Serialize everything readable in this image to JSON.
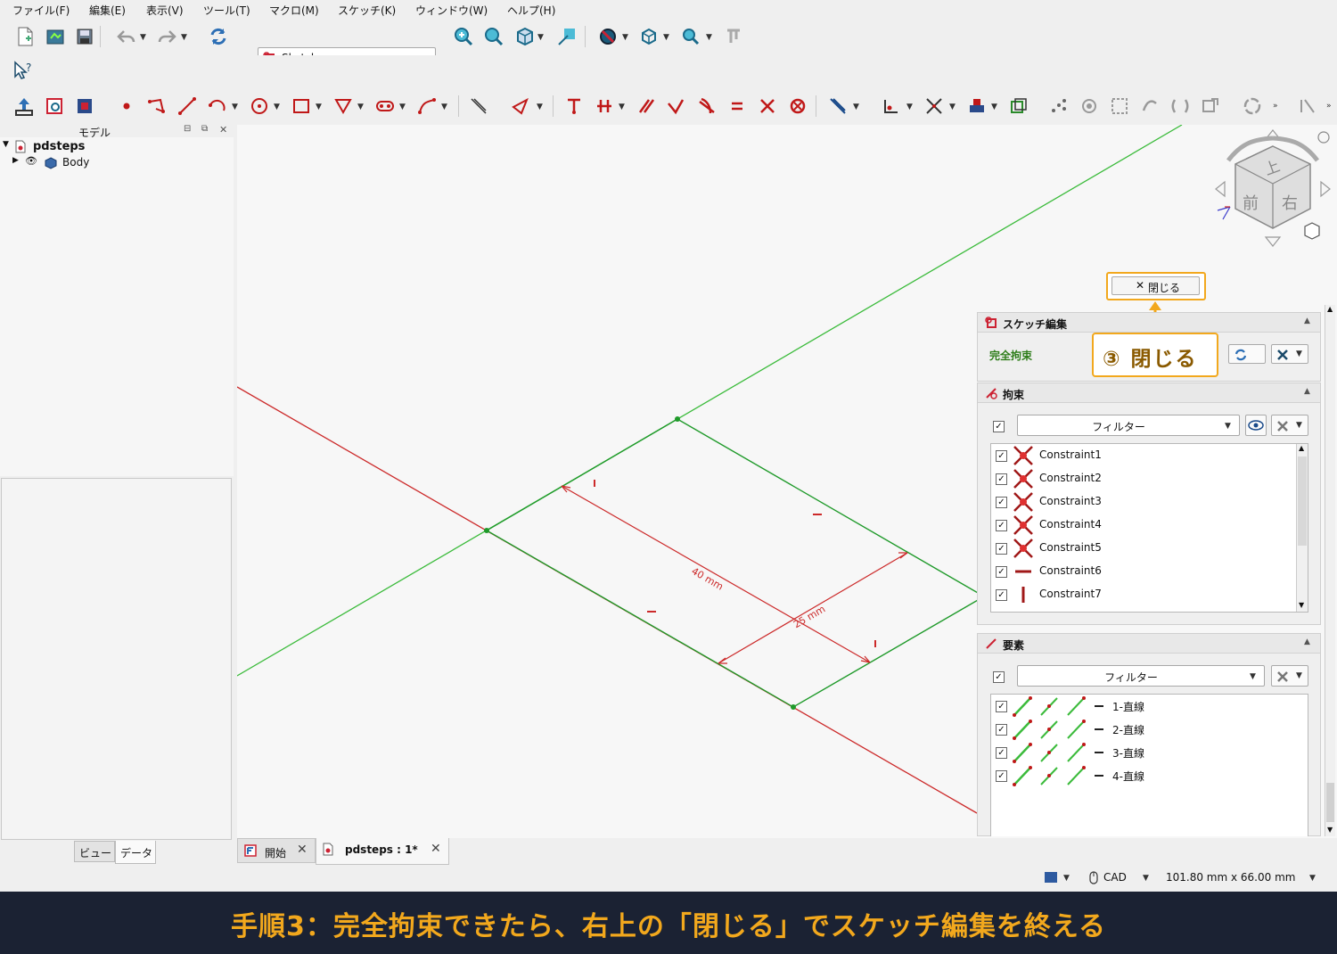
{
  "menu": [
    "ファイル(F)",
    "編集(E)",
    "表示(V)",
    "ツール(T)",
    "マクロ(M)",
    "スケッチ(K)",
    "ウィンドウ(W)",
    "ヘルプ(H)"
  ],
  "toolbar": {
    "workbench": "Sketcher"
  },
  "model_panel": {
    "title": "モデル",
    "tree": [
      {
        "label": "pdsteps"
      },
      {
        "label": "Body"
      }
    ],
    "tabs": [
      "ビュー",
      "データ"
    ]
  },
  "navcube": {
    "top": "上",
    "front": "前",
    "right": "右"
  },
  "viewport": {
    "dim_40": "40 mm",
    "dim_25": "25 mm",
    "close_button": "閉じる"
  },
  "annotation": {
    "label": "③ 閉じる",
    "color": "#f2a81d"
  },
  "sketch_edit": {
    "title": "スケッチ編集",
    "status": "完全拘束",
    "status_color": "#2e7d1a"
  },
  "constraints": {
    "title": "拘束",
    "filter": "フィルター",
    "items": [
      {
        "name": "Constraint1",
        "icon": "coincident-icon"
      },
      {
        "name": "Constraint2",
        "icon": "coincident-icon"
      },
      {
        "name": "Constraint3",
        "icon": "coincident-icon"
      },
      {
        "name": "Constraint4",
        "icon": "coincident-icon"
      },
      {
        "name": "Constraint5",
        "icon": "coincident-icon"
      },
      {
        "name": "Constraint6",
        "icon": "horizontal-icon"
      },
      {
        "name": "Constraint7",
        "icon": "vertical-icon"
      }
    ]
  },
  "elements": {
    "title": "要素",
    "filter": "フィルター",
    "items": [
      {
        "name": "1-直線"
      },
      {
        "name": "2-直線"
      },
      {
        "name": "3-直線"
      },
      {
        "name": "4-直線"
      }
    ]
  },
  "doc_tabs": [
    {
      "label": "開始"
    },
    {
      "label": "pdsteps : 1*"
    }
  ],
  "status_bar": {
    "nav_style": "CAD",
    "dimensions": "101.80 mm x 66.00 mm"
  },
  "caption": "手順3：完全拘束できたら、右上の「閉じる」でスケッチ編集を終える"
}
